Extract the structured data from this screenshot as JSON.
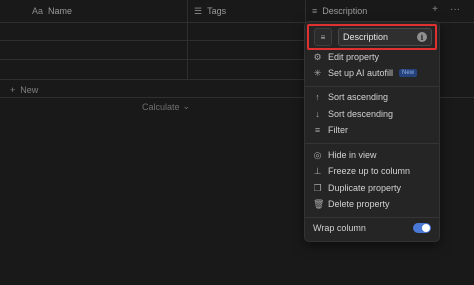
{
  "table": {
    "columns": [
      {
        "icon": "Aa",
        "label": "Name"
      },
      {
        "icon": "☰",
        "label": "Tags"
      },
      {
        "icon": "≡",
        "label": "Description"
      }
    ],
    "new_label": "New",
    "calculate_label": "Calculate",
    "add_column_icon": "+",
    "more_icon": "···"
  },
  "menu": {
    "name_value": "Description",
    "items": {
      "edit_property": "Edit property",
      "ai_autofill": "Set up AI autofill",
      "ai_badge": "New",
      "sort_asc": "Sort ascending",
      "sort_desc": "Sort descending",
      "filter": "Filter",
      "hide": "Hide in view",
      "freeze": "Freeze up to column",
      "duplicate": "Duplicate property",
      "delete": "Delete property",
      "wrap": "Wrap column"
    },
    "wrap_enabled": true
  }
}
